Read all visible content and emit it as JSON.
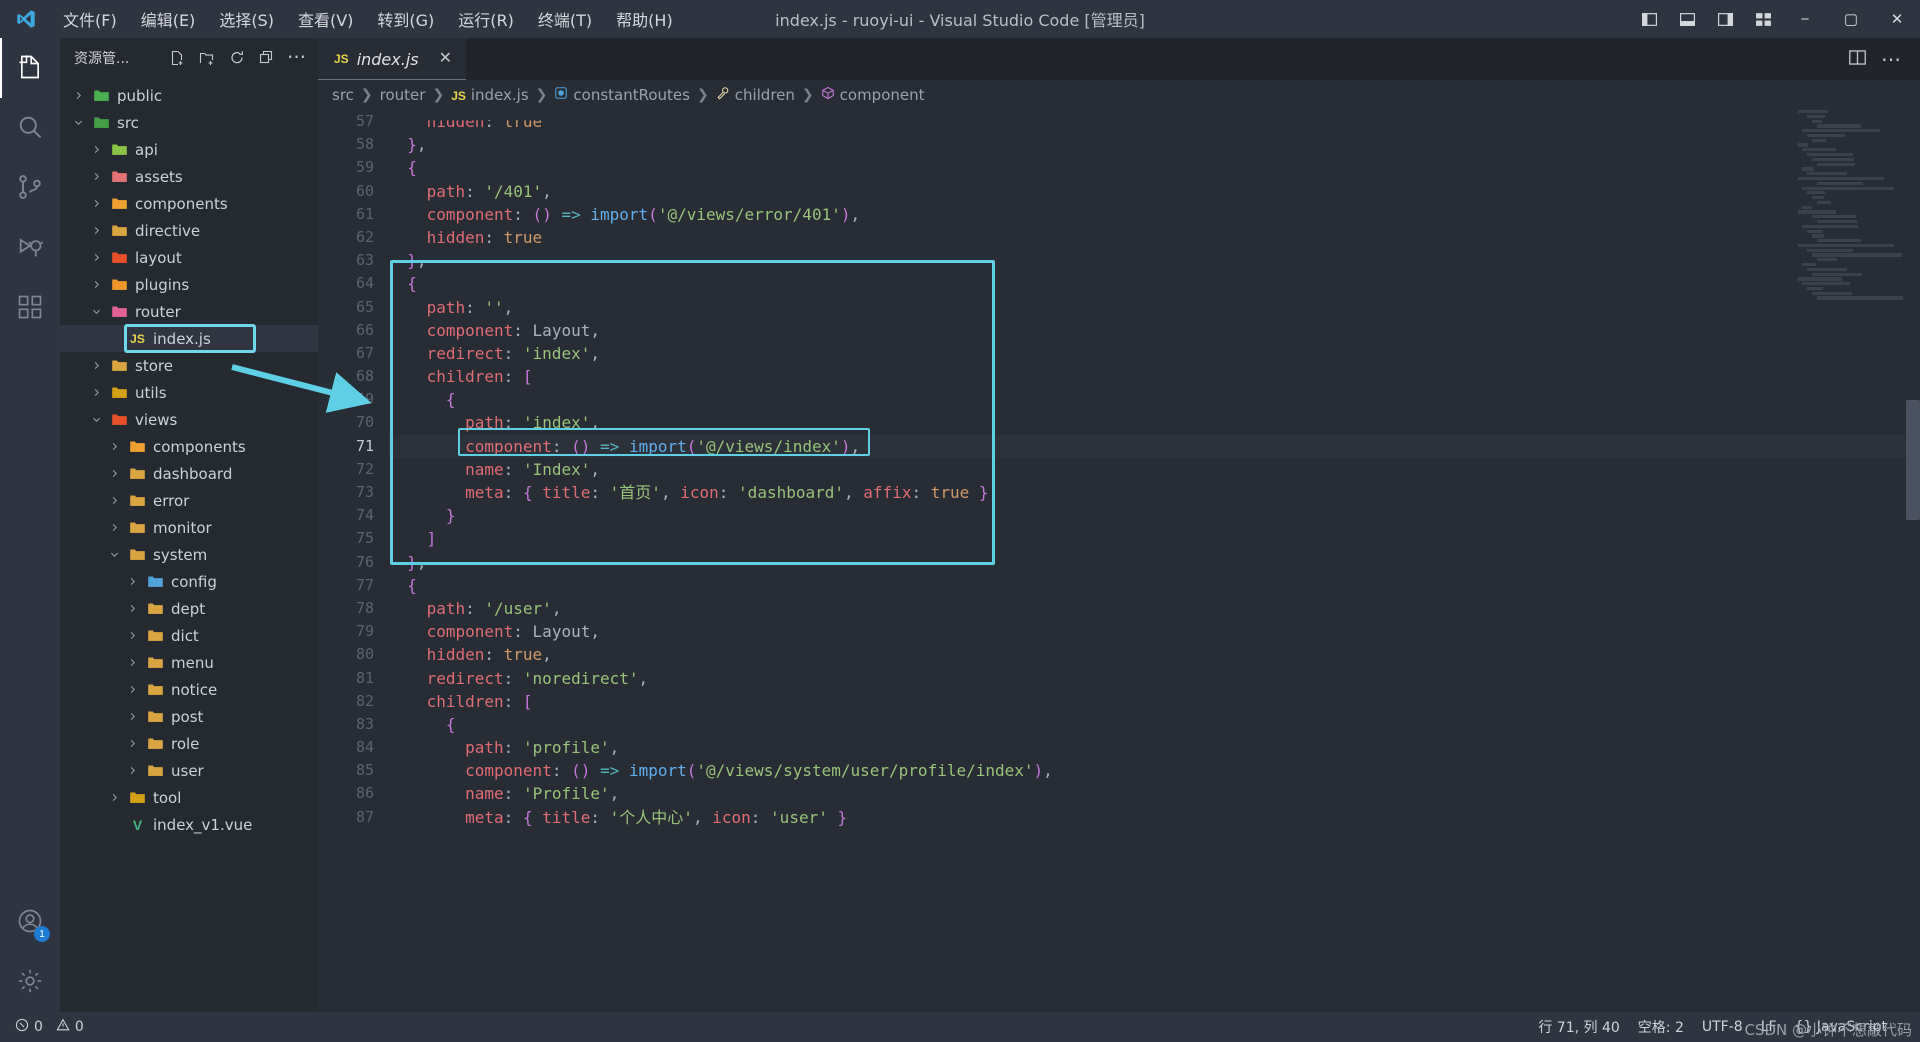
{
  "titlebar": {
    "logo_icon": "vscode-logo-icon",
    "menus": [
      "文件(F)",
      "编辑(E)",
      "选择(S)",
      "查看(V)",
      "转到(G)",
      "运行(R)",
      "终端(T)",
      "帮助(H)"
    ],
    "window_title": "index.js - ruoyi-ui - Visual Studio Code [管理员]",
    "layout_buttons": [
      "toggle-primary-sidebar-icon",
      "toggle-panel-icon",
      "toggle-secondary-sidebar-icon",
      "customize-layout-icon"
    ],
    "window_controls": {
      "minimize": "−",
      "maximize": "▢",
      "close": "✕"
    }
  },
  "activitybar": {
    "items": [
      {
        "name": "explorer",
        "icon": "files-icon",
        "active": true
      },
      {
        "name": "search",
        "icon": "search-icon",
        "active": false
      },
      {
        "name": "source-control",
        "icon": "source-control-icon",
        "active": false
      },
      {
        "name": "run-debug",
        "icon": "run-debug-icon",
        "active": false
      },
      {
        "name": "extensions",
        "icon": "extensions-icon",
        "active": false
      }
    ],
    "bottom": [
      {
        "name": "accounts",
        "icon": "account-icon",
        "badge": "1"
      },
      {
        "name": "settings",
        "icon": "gear-icon",
        "badge": ""
      }
    ]
  },
  "sidebar": {
    "title": "资源管...",
    "actions": [
      "new-file-icon",
      "new-folder-icon",
      "refresh-icon",
      "collapse-all-icon",
      "more-actions-icon"
    ],
    "tree": [
      {
        "label": "public",
        "depth": 0,
        "state": "collapsed",
        "icon": "folder-public",
        "color": "#4caf50"
      },
      {
        "label": "src",
        "depth": 0,
        "state": "expanded",
        "icon": "folder-src",
        "color": "#43a047"
      },
      {
        "label": "api",
        "depth": 1,
        "state": "collapsed",
        "icon": "folder-api",
        "color": "#8bc34a"
      },
      {
        "label": "assets",
        "depth": 1,
        "state": "collapsed",
        "icon": "folder-assets",
        "color": "#e57373"
      },
      {
        "label": "components",
        "depth": 1,
        "state": "collapsed",
        "icon": "folder-components",
        "color": "#f0a030"
      },
      {
        "label": "directive",
        "depth": 1,
        "state": "collapsed",
        "icon": "folder-plain",
        "color": "#d9a441"
      },
      {
        "label": "layout",
        "depth": 1,
        "state": "collapsed",
        "icon": "folder-layout",
        "color": "#e8502a"
      },
      {
        "label": "plugins",
        "depth": 1,
        "state": "collapsed",
        "icon": "folder-plugins",
        "color": "#f0962a"
      },
      {
        "label": "router",
        "depth": 1,
        "state": "expanded",
        "icon": "folder-router",
        "color": "#e06292"
      },
      {
        "label": "index.js",
        "depth": 2,
        "state": "file",
        "icon": "js-file-icon",
        "color": "#e8d44d",
        "selected": true,
        "annotated": true
      },
      {
        "label": "store",
        "depth": 1,
        "state": "collapsed",
        "icon": "folder-plain",
        "color": "#d9a441"
      },
      {
        "label": "utils",
        "depth": 1,
        "state": "collapsed",
        "icon": "folder-utils",
        "color": "#d4a017"
      },
      {
        "label": "views",
        "depth": 1,
        "state": "expanded",
        "icon": "folder-views",
        "color": "#e8502a"
      },
      {
        "label": "components",
        "depth": 2,
        "state": "collapsed",
        "icon": "folder-components",
        "color": "#f0a030"
      },
      {
        "label": "dashboard",
        "depth": 2,
        "state": "collapsed",
        "icon": "folder-plain",
        "color": "#d9a441"
      },
      {
        "label": "error",
        "depth": 2,
        "state": "collapsed",
        "icon": "folder-plain",
        "color": "#d9a441"
      },
      {
        "label": "monitor",
        "depth": 2,
        "state": "collapsed",
        "icon": "folder-plain",
        "color": "#d9a441"
      },
      {
        "label": "system",
        "depth": 2,
        "state": "expanded",
        "icon": "folder-plain",
        "color": "#d9a441"
      },
      {
        "label": "config",
        "depth": 3,
        "state": "collapsed",
        "icon": "folder-config",
        "color": "#4fa3d9"
      },
      {
        "label": "dept",
        "depth": 3,
        "state": "collapsed",
        "icon": "folder-plain",
        "color": "#d9a441"
      },
      {
        "label": "dict",
        "depth": 3,
        "state": "collapsed",
        "icon": "folder-plain",
        "color": "#d9a441"
      },
      {
        "label": "menu",
        "depth": 3,
        "state": "collapsed",
        "icon": "folder-plain",
        "color": "#d9a441"
      },
      {
        "label": "notice",
        "depth": 3,
        "state": "collapsed",
        "icon": "folder-plain",
        "color": "#d9a441"
      },
      {
        "label": "post",
        "depth": 3,
        "state": "collapsed",
        "icon": "folder-plain",
        "color": "#d9a441"
      },
      {
        "label": "role",
        "depth": 3,
        "state": "collapsed",
        "icon": "folder-plain",
        "color": "#d9a441"
      },
      {
        "label": "user",
        "depth": 3,
        "state": "collapsed",
        "icon": "folder-plain",
        "color": "#d9a441"
      },
      {
        "label": "tool",
        "depth": 2,
        "state": "collapsed",
        "icon": "folder-tool",
        "color": "#d4a017"
      },
      {
        "label": "index_v1.vue",
        "depth": 2,
        "state": "file",
        "icon": "vue-file-icon",
        "color": "#41b883"
      }
    ]
  },
  "editor": {
    "tab": {
      "icon": "js-file-icon",
      "icon_label": "JS",
      "name": "index.js",
      "close": "✕"
    },
    "tab_actions": [
      "split-editor-icon",
      "more-actions-icon"
    ],
    "breadcrumb": [
      {
        "label": "src",
        "icon": ""
      },
      {
        "label": "router",
        "icon": ""
      },
      {
        "label": "index.js",
        "icon": "js-file-icon"
      },
      {
        "label": "constantRoutes",
        "icon": "variable-icon"
      },
      {
        "label": "children",
        "icon": "property-icon"
      },
      {
        "label": "component",
        "icon": "module-icon"
      }
    ],
    "first_line_number": 57,
    "current_line": 71,
    "lines": [
      {
        "n": 57,
        "text": "    hidden: true",
        "clipped": true
      },
      {
        "n": 58,
        "text": "  },"
      },
      {
        "n": 59,
        "text": "  {"
      },
      {
        "n": 60,
        "text": "    path: '/401',"
      },
      {
        "n": 61,
        "text": "    component: () => import('@/views/error/401'),"
      },
      {
        "n": 62,
        "text": "    hidden: true"
      },
      {
        "n": 63,
        "text": "  },"
      },
      {
        "n": 64,
        "text": "  {"
      },
      {
        "n": 65,
        "text": "    path: '',"
      },
      {
        "n": 66,
        "text": "    component: Layout,"
      },
      {
        "n": 67,
        "text": "    redirect: 'index',"
      },
      {
        "n": 68,
        "text": "    children: ["
      },
      {
        "n": 69,
        "text": "      {"
      },
      {
        "n": 70,
        "text": "        path: 'index',"
      },
      {
        "n": 71,
        "text": "        component: () => import('@/views/index'),"
      },
      {
        "n": 72,
        "text": "        name: 'Index',"
      },
      {
        "n": 73,
        "text": "        meta: { title: '首页', icon: 'dashboard', affix: true }"
      },
      {
        "n": 74,
        "text": "      }"
      },
      {
        "n": 75,
        "text": "    ]"
      },
      {
        "n": 76,
        "text": "  },"
      },
      {
        "n": 77,
        "text": "  {"
      },
      {
        "n": 78,
        "text": "    path: '/user',"
      },
      {
        "n": 79,
        "text": "    component: Layout,"
      },
      {
        "n": 80,
        "text": "    hidden: true,"
      },
      {
        "n": 81,
        "text": "    redirect: 'noredirect',"
      },
      {
        "n": 82,
        "text": "    children: ["
      },
      {
        "n": 83,
        "text": "      {"
      },
      {
        "n": 84,
        "text": "        path: 'profile',"
      },
      {
        "n": 85,
        "text": "        component: () => import('@/views/system/user/profile/index'),"
      },
      {
        "n": 86,
        "text": "        name: 'Profile',"
      },
      {
        "n": 87,
        "text": "        meta: { title: '个人中心', icon: 'user' }"
      }
    ]
  },
  "annotations": {
    "accent_color": "#5ecfe4",
    "boxes": [
      "sidebar-index-js-box",
      "code-block-box",
      "code-line-71-box"
    ],
    "arrow": "pointer-arrow"
  },
  "statusbar": {
    "left": [
      {
        "name": "problems",
        "icon": "error-icon",
        "text": "0"
      },
      {
        "name": "warnings",
        "icon": "warning-icon",
        "text": "0"
      }
    ],
    "right": [
      {
        "name": "cursor-position",
        "text": "行 71, 列 40"
      },
      {
        "name": "indentation",
        "text": "空格: 2"
      },
      {
        "name": "encoding",
        "text": "UTF-8"
      },
      {
        "name": "eol",
        "text": "LF"
      },
      {
        "name": "language-mode",
        "text": "{} JavaScript"
      }
    ],
    "watermark": "CSDN @小钟不想敲代码"
  }
}
